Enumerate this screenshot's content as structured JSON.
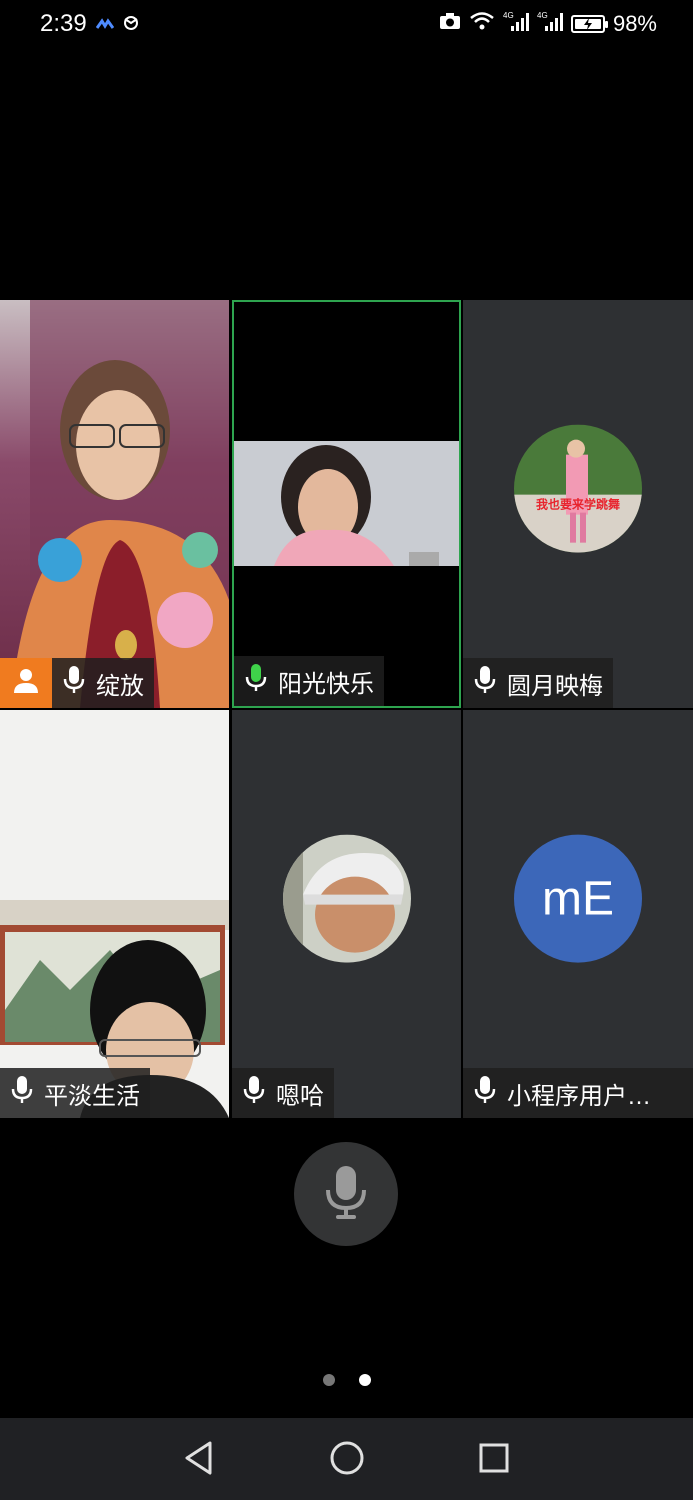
{
  "status_bar": {
    "time": "2:39",
    "battery_percent": "98%",
    "icons": [
      "meteor-icon",
      "sync-icon",
      "camera-icon",
      "wifi-icon",
      "signal-4g-icon",
      "signal-4g-icon",
      "battery-charging-icon"
    ]
  },
  "participants": [
    {
      "name": "绽放",
      "video": "camera",
      "speaking": false,
      "host_badge": true
    },
    {
      "name": "阳光快乐",
      "video": "camera",
      "speaking": true,
      "active": true
    },
    {
      "name": "圆月映梅",
      "video": "avatar-photo",
      "speaking": false
    },
    {
      "name": "平淡生活",
      "video": "camera",
      "speaking": false
    },
    {
      "name": "嗯哈",
      "video": "avatar-photo",
      "speaking": false
    },
    {
      "name": "小程序用户…",
      "video": "avatar-initials",
      "initials": "mE",
      "speaking": false
    }
  ],
  "avatar_banner_text": "我也要来学跳舞",
  "pagination": {
    "current_page": 2,
    "total_pages": 2
  },
  "colors": {
    "tile_bg": "#2e3033",
    "active_border": "#2ea44f",
    "speaking_mic": "#3fd34a",
    "host_badge": "#f07b1f",
    "initials_avatar": "#3c67b9"
  }
}
